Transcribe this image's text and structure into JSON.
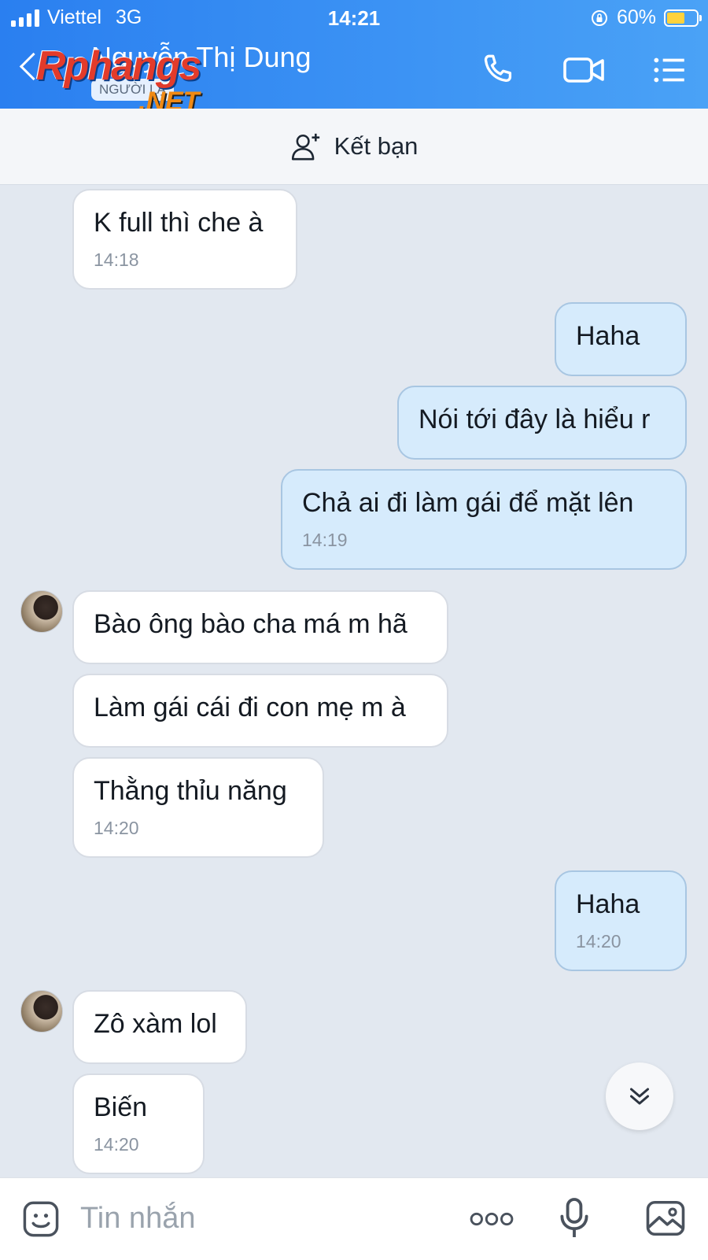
{
  "status_bar": {
    "carrier": "Viettel",
    "network": "3G",
    "time": "14:21",
    "battery": "60%",
    "battery_level": 0.6
  },
  "header": {
    "contact_name": "Nguyễn Thị Dung",
    "badge": "NGƯỜI LẠ",
    "watermark_line1": "Rphangs",
    "watermark_line2": ".NET",
    "icons": [
      "back-icon",
      "phone-icon",
      "video-call-icon",
      "menu-list-icon"
    ]
  },
  "friend_bar": {
    "label": "Kết bạn",
    "icon": "add-friend-icon"
  },
  "messages": [
    {
      "side": "in",
      "text": "K full thì che à",
      "time": "14:18"
    },
    {
      "side": "out",
      "text": "Haha",
      "time": ""
    },
    {
      "side": "out",
      "text": "Nói tới đây là hiểu r",
      "time": ""
    },
    {
      "side": "out",
      "text": "Chả ai đi làm gái để mặt lên",
      "time": "14:19"
    },
    {
      "side": "in",
      "text": "Bào ông bào cha má m hã",
      "time": ""
    },
    {
      "side": "in",
      "text": "Làm gái cái đi con mẹ m à",
      "time": ""
    },
    {
      "side": "in",
      "text": "Thằng thỉu năng",
      "time": "14:20"
    },
    {
      "side": "out",
      "text": "Haha",
      "time": "14:20"
    },
    {
      "side": "in",
      "text": "Zô xàm lol",
      "time": ""
    },
    {
      "side": "in",
      "text": "Biến",
      "time": "14:20"
    }
  ],
  "input_bar": {
    "placeholder": "Tin nhắn",
    "icons": [
      "sticker-icon",
      "more-icon",
      "microphone-icon",
      "image-icon"
    ]
  },
  "colors": {
    "header": "#3d94f4",
    "incoming_bubble": "#ffffff",
    "outgoing_bubble": "#d6ebfc",
    "chat_background": "#e2e8f0"
  }
}
